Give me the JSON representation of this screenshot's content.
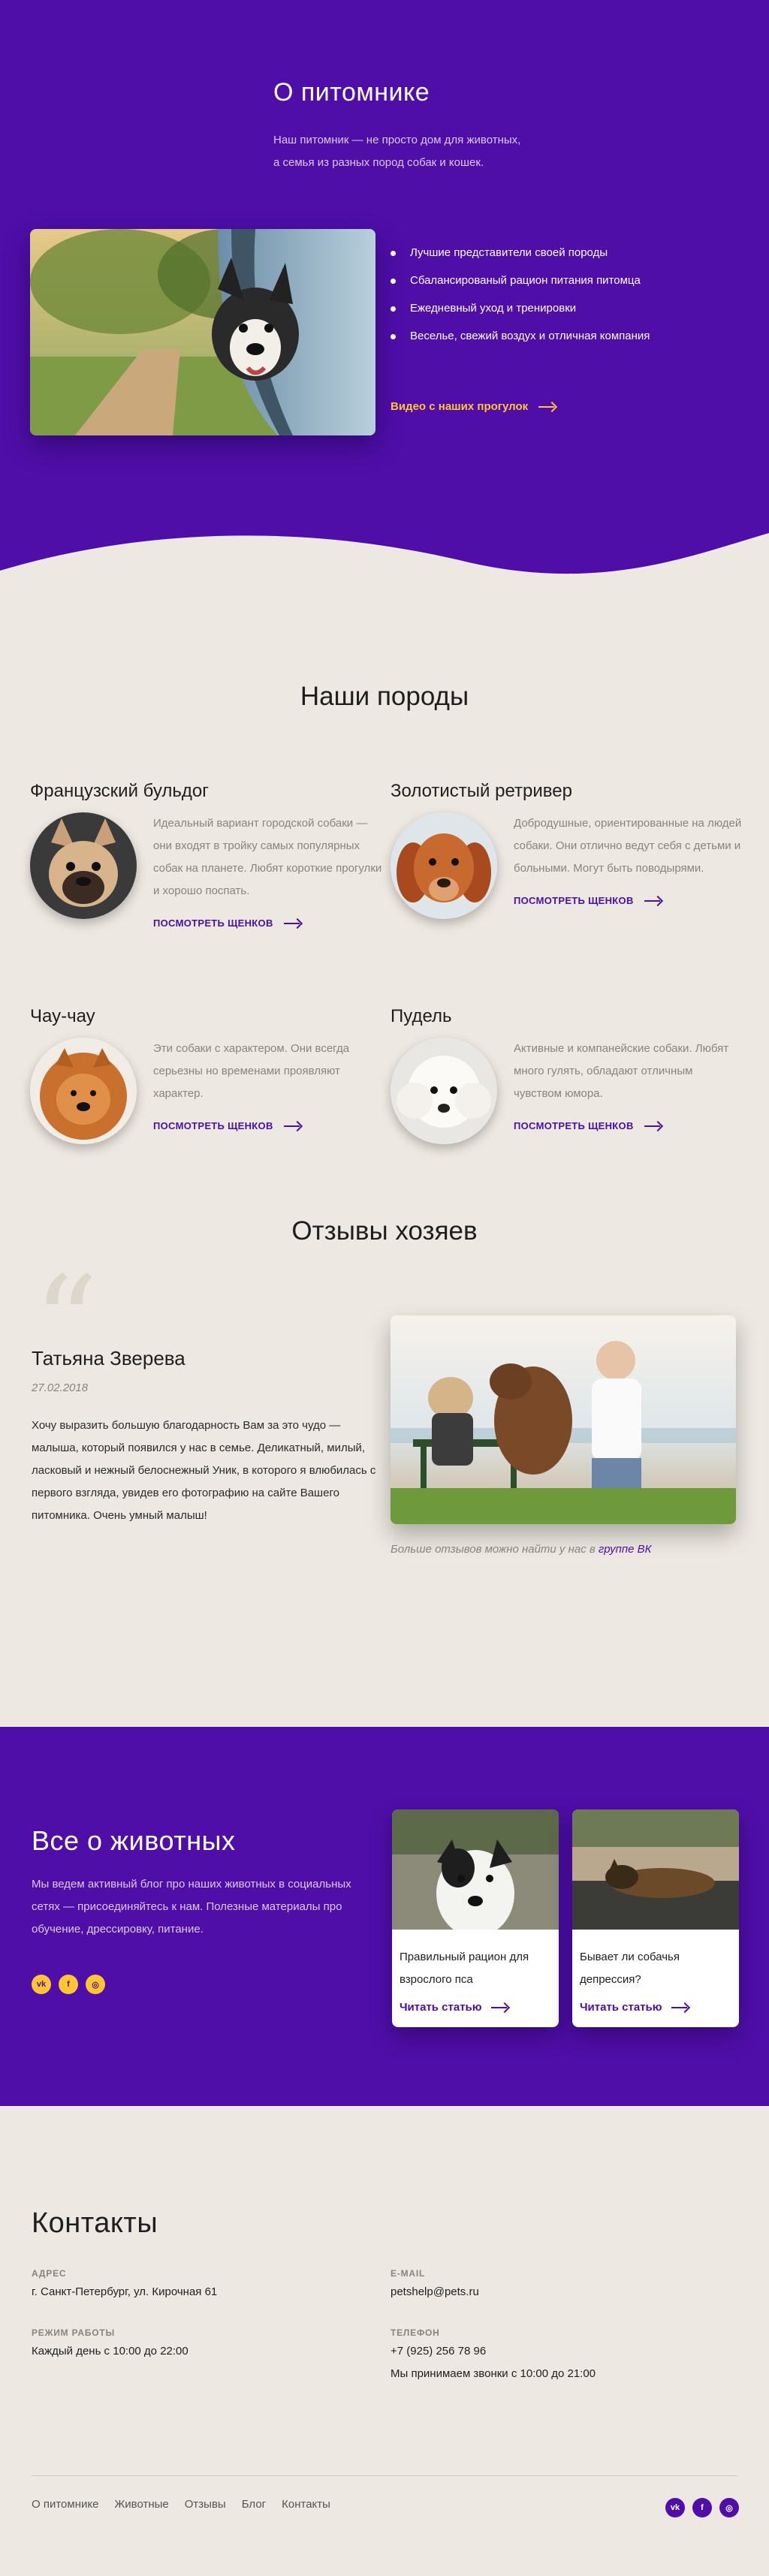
{
  "about": {
    "title": "О питомнике",
    "text_line1": "Наш питомник — не просто дом для животных,",
    "text_line2": "а семья из разных пород собак и кошек.",
    "photo_alt": "dog-in-car-window",
    "features": [
      "Лучшие представители своей породы",
      "Сбалансированый рацион питания питомца",
      "Ежедневный уход и тренировки",
      "Веселье, свежий воздух и отличная компания"
    ],
    "video_link": "Видео с наших прогулок"
  },
  "breeds": {
    "title": "Наши породы",
    "more_label": "ПОСМОТРЕТЬ ЩЕНКОВ",
    "items": [
      {
        "name": "Французский бульдог",
        "desc": "Идеальный вариант городской собаки — они входят в тройку самых популярных собак на планете. Любят короткие прогулки и хорошо поспать."
      },
      {
        "name": "Золотистый ретривер",
        "desc": "Добродушные, ориентированные на людей собаки. Они отлично ведут себя с детьми и больными. Могут быть поводырями."
      },
      {
        "name": "Чау-чау",
        "desc": "Эти собаки с характером. Они всегда серьезны но временами проявляют характер."
      },
      {
        "name": "Пудель",
        "desc": "Активные и компанейские собаки. Любят много гулять, обладают отличным чувством юмора."
      }
    ]
  },
  "reviews": {
    "title": "Отзывы хозяев",
    "quote_mark": "“",
    "name": "Татьяна Зверева",
    "date": "27.02.2018",
    "text": "Хочу выразить большую благодарность Вам за это чудо — малыша, который появился у нас в семье. Деликатный, милый, ласковый и нежный белоснежный Уник, в которого я влюбилась с первого взгляда, увидев его фотографию на сайте Вашего питомника. Очень умный малыш!",
    "more_prefix": "Больше отзывов можно найти у нас в ",
    "more_link": "группе ВК"
  },
  "blog": {
    "title": "Все о животных",
    "text": "Мы ведем активный блог про наших животных в социальных сетях — присоединяйтесь к нам. Полезные материалы про обучение, дрессировку, питание.",
    "read_label": "Читать статью",
    "cards": [
      {
        "title": "Правильный рацион для взрослого пса"
      },
      {
        "title": "Бывает ли собачья депрессия?"
      }
    ]
  },
  "socials": [
    {
      "icon": "vk-icon",
      "glyph": "vk"
    },
    {
      "icon": "facebook-icon",
      "glyph": "f"
    },
    {
      "icon": "instagram-icon",
      "glyph": "◎"
    }
  ],
  "contacts": {
    "title": "Контакты",
    "address_label": "АДРЕС",
    "address": "г. Санкт-Петербург, ул. Кирочная 61",
    "hours_label": "РЕЖИМ РАБОТЫ",
    "hours": "Каждый день с 10:00 до 22:00",
    "email_label": "E-MAIL",
    "email": "petshelp@pets.ru",
    "phone_label": "ТЕЛЕФОН",
    "phone": "+7 (925) 256 78 96",
    "phone_note": "Мы принимаем звонки с 10:00 до 21:00"
  },
  "footer_nav": [
    "О питомнике",
    "Животные",
    "Отзывы",
    "Блог",
    "Контакты"
  ],
  "colors": {
    "brand_purple": "#4f0ea8",
    "accent_yellow": "#ffc533",
    "background_beige": "#ede8e1"
  }
}
